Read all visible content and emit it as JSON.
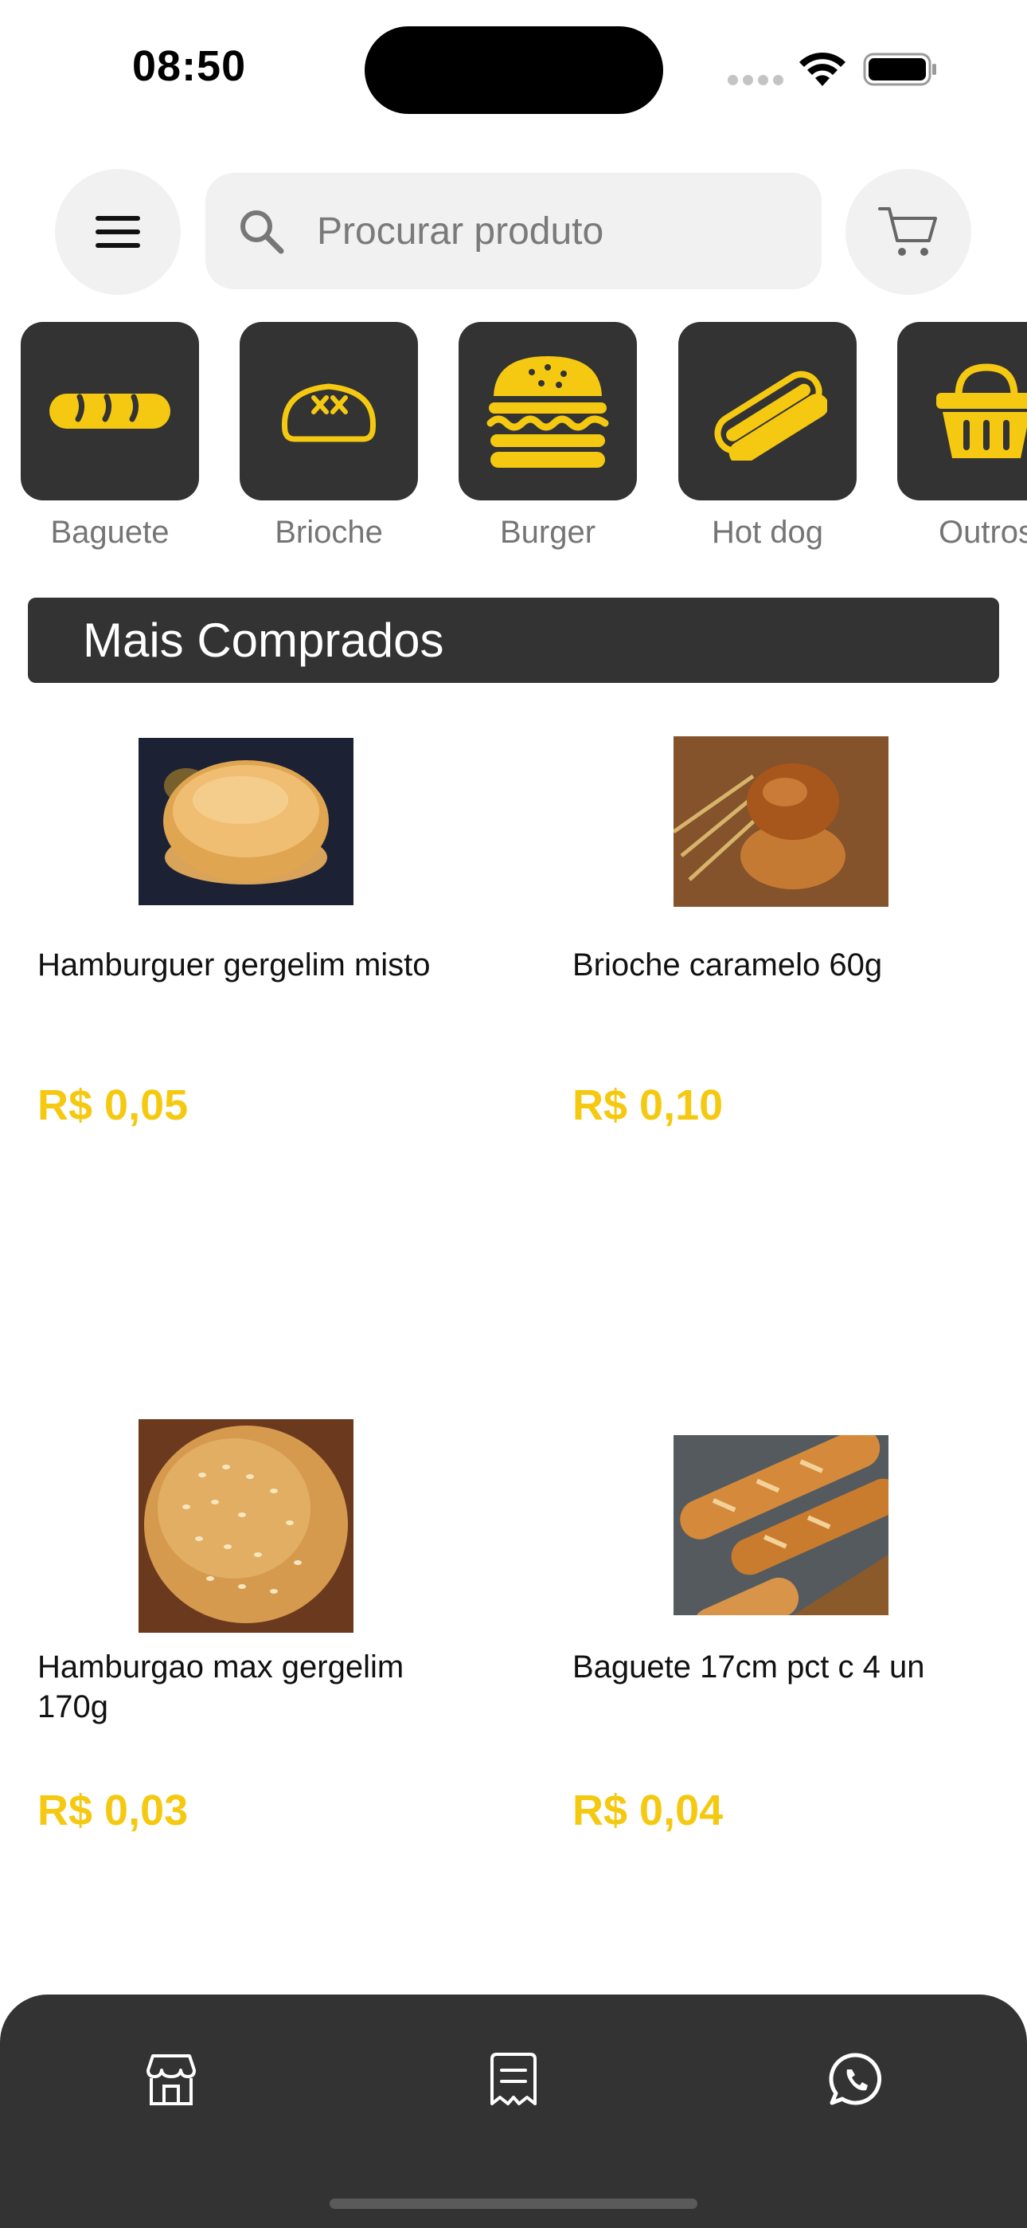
{
  "status_bar": {
    "time": "08:50"
  },
  "header": {
    "search_placeholder": "Procurar produto"
  },
  "categories": [
    {
      "label": "Baguete",
      "icon": "baguette-icon"
    },
    {
      "label": "Brioche",
      "icon": "bread-loaf-icon"
    },
    {
      "label": "Burger",
      "icon": "burger-icon"
    },
    {
      "label": "Hot dog",
      "icon": "hotdog-icon"
    },
    {
      "label": "Outros",
      "icon": "basket-icon"
    }
  ],
  "section": {
    "title": "Mais Comprados"
  },
  "products": [
    {
      "name": "Hamburguer gergelim misto",
      "price": "R$ 0,05"
    },
    {
      "name": "Brioche caramelo 60g",
      "price": "R$ 0,10"
    },
    {
      "name": "Hamburgao max gergelim 170g",
      "price": "R$ 0,03"
    },
    {
      "name": "Baguete 17cm pct c 4 un",
      "price": "R$ 0,04"
    }
  ],
  "bottom_nav": [
    {
      "icon": "store-icon"
    },
    {
      "icon": "receipt-icon"
    },
    {
      "icon": "whatsapp-icon"
    }
  ],
  "colors": {
    "accent": "#f5c911",
    "dark": "#333333",
    "light_bg": "#f1f1f1"
  }
}
